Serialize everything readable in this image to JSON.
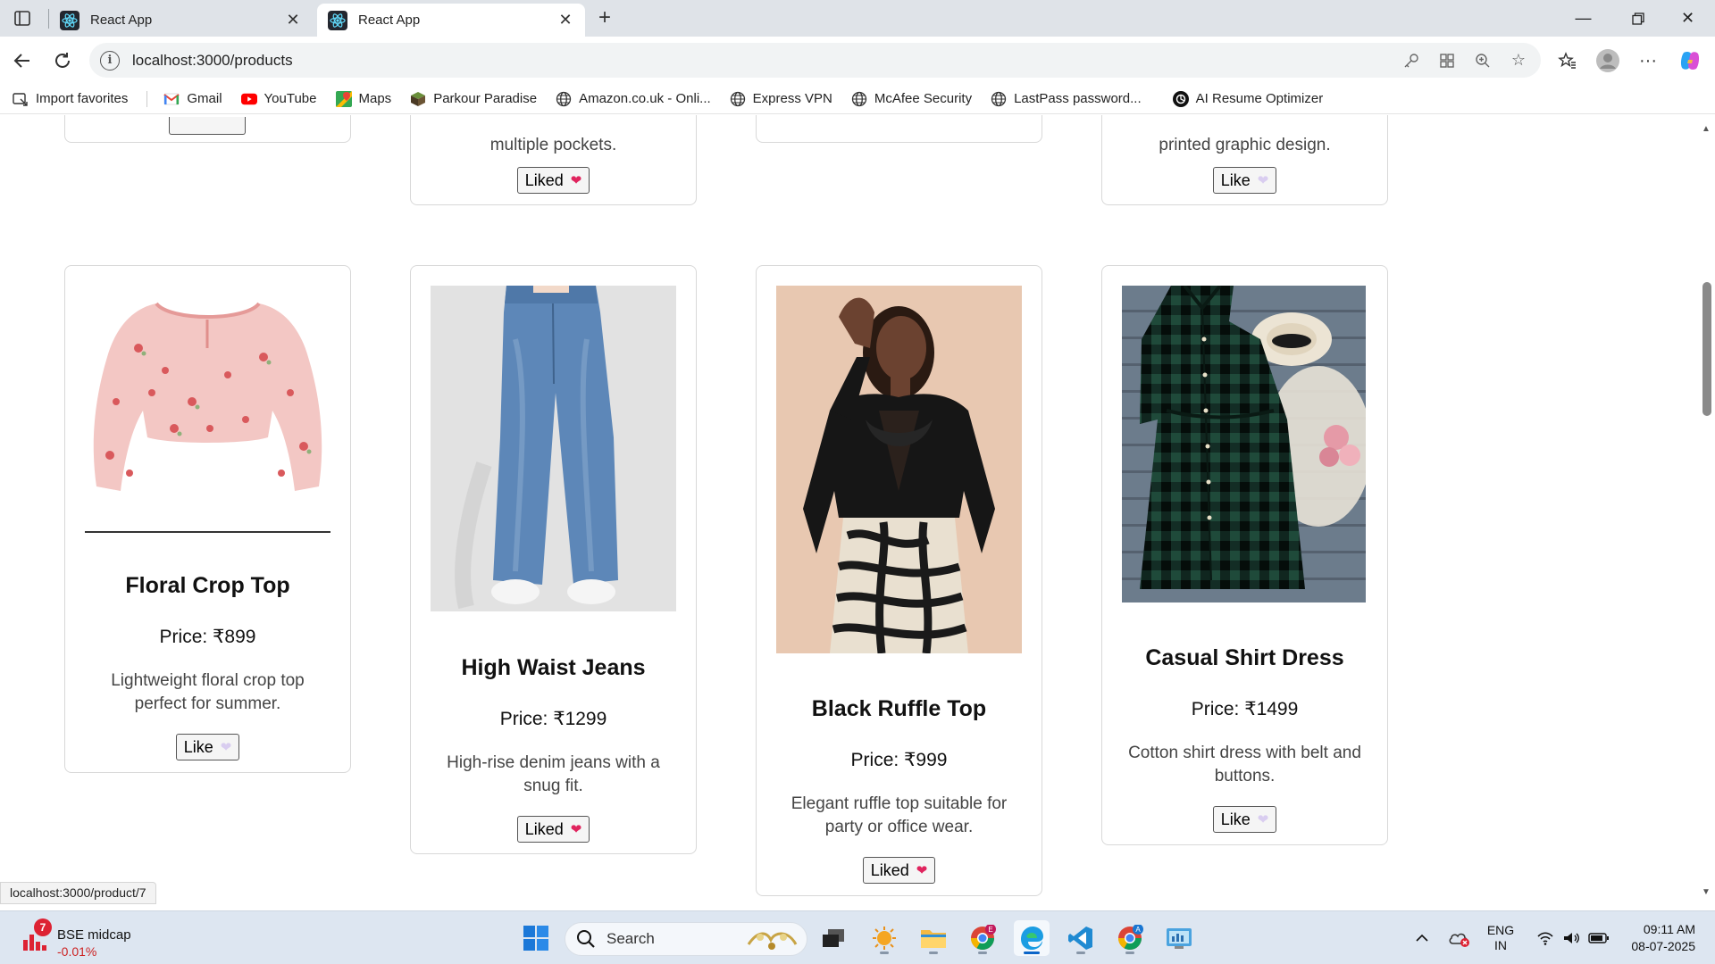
{
  "browser": {
    "tabs": [
      {
        "title": "React App",
        "active": false
      },
      {
        "title": "React App",
        "active": true
      }
    ],
    "url": "localhost:3000/products",
    "bookmarks": [
      {
        "label": "Import favorites",
        "icon": "import-icon"
      },
      {
        "label": "Gmail",
        "icon": "gmail-icon"
      },
      {
        "label": "YouTube",
        "icon": "youtube-icon"
      },
      {
        "label": "Maps",
        "icon": "maps-icon"
      },
      {
        "label": "Parkour Paradise",
        "icon": "cube-icon"
      },
      {
        "label": "Amazon.co.uk - Onli...",
        "icon": "globe-icon"
      },
      {
        "label": "Express VPN",
        "icon": "globe-icon"
      },
      {
        "label": "McAfee Security",
        "icon": "globe-icon"
      },
      {
        "label": "LastPass password...",
        "icon": "globe-icon"
      },
      {
        "label": "AI Resume Optimizer",
        "icon": "openai-icon"
      }
    ],
    "status_url": "localhost:3000/product/7"
  },
  "products_partial": [
    {
      "desc_line": "multiple pockets.",
      "like_label": "Liked",
      "liked": true
    },
    {
      "desc_line": "printed graphic design.",
      "like_label": "Like",
      "liked": false
    }
  ],
  "products": [
    {
      "name": "Floral Crop Top",
      "price": "Price: ₹899",
      "description": "Lightweight floral crop top perfect for summer.",
      "like_label": "Like",
      "liked": false,
      "image": "pink floral crop top"
    },
    {
      "name": "High Waist Jeans",
      "price": "Price: ₹1299",
      "description": "High-rise denim jeans with a snug fit.",
      "like_label": "Liked",
      "liked": true,
      "image": "blue wide-leg jeans"
    },
    {
      "name": "Black Ruffle Top",
      "price": "Price: ₹999",
      "description": "Elegant ruffle top suitable for party or office wear.",
      "like_label": "Liked",
      "liked": true,
      "image": "black ruffle top with zebra skirt"
    },
    {
      "name": "Casual Shirt Dress",
      "price": "Price: ₹1499",
      "description": "Cotton shirt dress with belt and buttons.",
      "like_label": "Like",
      "liked": false,
      "image": "green plaid shirt dress"
    }
  ],
  "taskbar": {
    "widget_title": "BSE midcap",
    "widget_value": "-0.01%",
    "widget_badge": "7",
    "search_placeholder": "Search",
    "lang_line1": "ENG",
    "lang_line2": "IN",
    "time": "09:11 AM",
    "date": "08-07-2025"
  },
  "colors": {
    "liked_heart": "#e0245e",
    "unliked_heart": "#d9cdf0",
    "taskbar": "#dde6f1"
  }
}
